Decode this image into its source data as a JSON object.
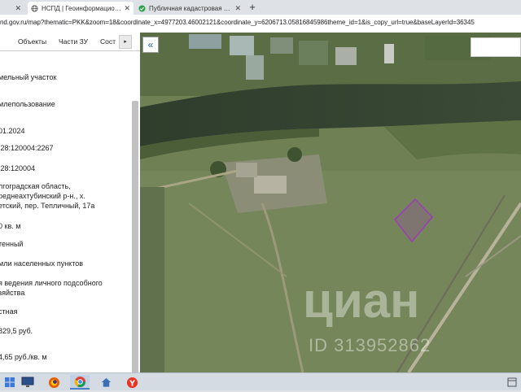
{
  "browser": {
    "tabs": [
      {
        "title": "",
        "close": "✕"
      },
      {
        "title": "НСПД | Геоинформационный п",
        "close": "✕"
      },
      {
        "title": "Публичная кадастровая карта",
        "close": "✕"
      }
    ],
    "new_tab": "+",
    "address": "nd.gov.ru/map?thematic=PKK&zoom=18&coordinate_x=4977203.46002121&coordinate_y=6206713.05816845986theme_id=1&is_copy_url=true&baseLayerId=36345"
  },
  "panel": {
    "tabs": [
      "",
      "Объекты",
      "Части ЗУ",
      "Сост"
    ],
    "next": "▸",
    "fields": [
      "мельный участок",
      "млепользование",
      "01.2024",
      ":28:120004:2267",
      ":28:120004",
      "лгоградская область,\nреднеахтубинский р-н., х.\nетский, пер. Тепличный, 17а",
      "0 кв. м",
      "тенный",
      "мли населенных пунктов",
      "я ведения личного подсобного\nзяйства",
      "стная",
      " 829,5 руб.",
      "4,65 руб./кв. м"
    ]
  },
  "map": {
    "collapse": "«",
    "watermark": "циан",
    "watermark_id": "ID 313952862"
  },
  "colors": {
    "parcel": "#9b3fb5",
    "accent": "#1a5fb4"
  }
}
